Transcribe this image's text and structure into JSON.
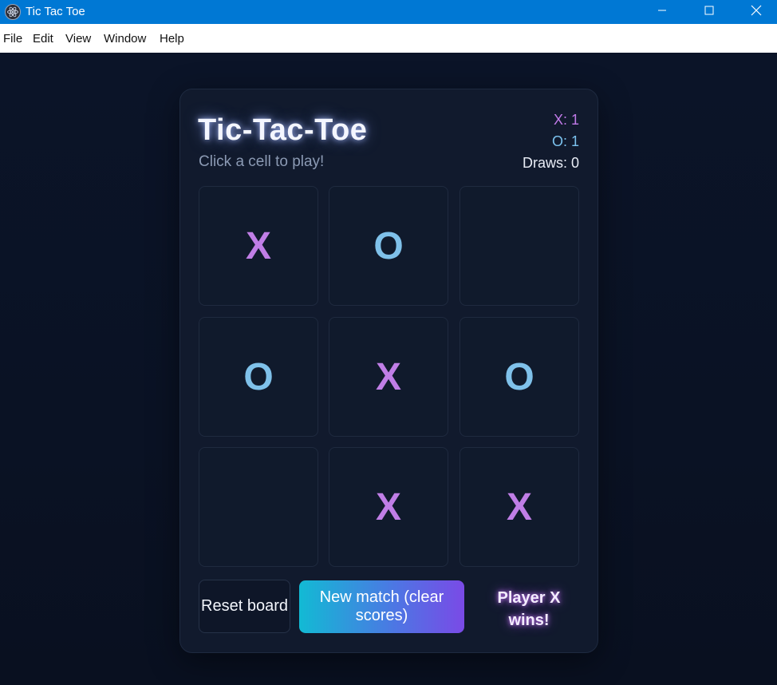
{
  "window": {
    "title": "Tic Tac Toe",
    "app_icon": "electron-icon",
    "controls": {
      "minimize": "minimize-icon",
      "maximize": "maximize-icon",
      "close": "close-icon"
    }
  },
  "menu": [
    "File",
    "Edit",
    "View",
    "Window",
    "Help"
  ],
  "game": {
    "title": "Tic-Tac-Toe",
    "subtitle": "Click a cell to play!",
    "scores": {
      "x": "X: 1",
      "o": "O: 1",
      "draws": "Draws: 0"
    },
    "board": [
      "X",
      "O",
      "",
      "O",
      "X",
      "O",
      "",
      "X",
      "X"
    ],
    "reset_label": "Reset board",
    "new_match_label": "New match (clear scores)",
    "status": "Player X wins!"
  },
  "colors": {
    "titlebar": "#0078d4",
    "background": "#0a1122",
    "card": "#111a2d",
    "x_mark": "#c07ee6",
    "o_mark": "#7fc1ea",
    "accent_gradient_start": "#12bad4",
    "accent_gradient_end": "#7a4ae6"
  }
}
